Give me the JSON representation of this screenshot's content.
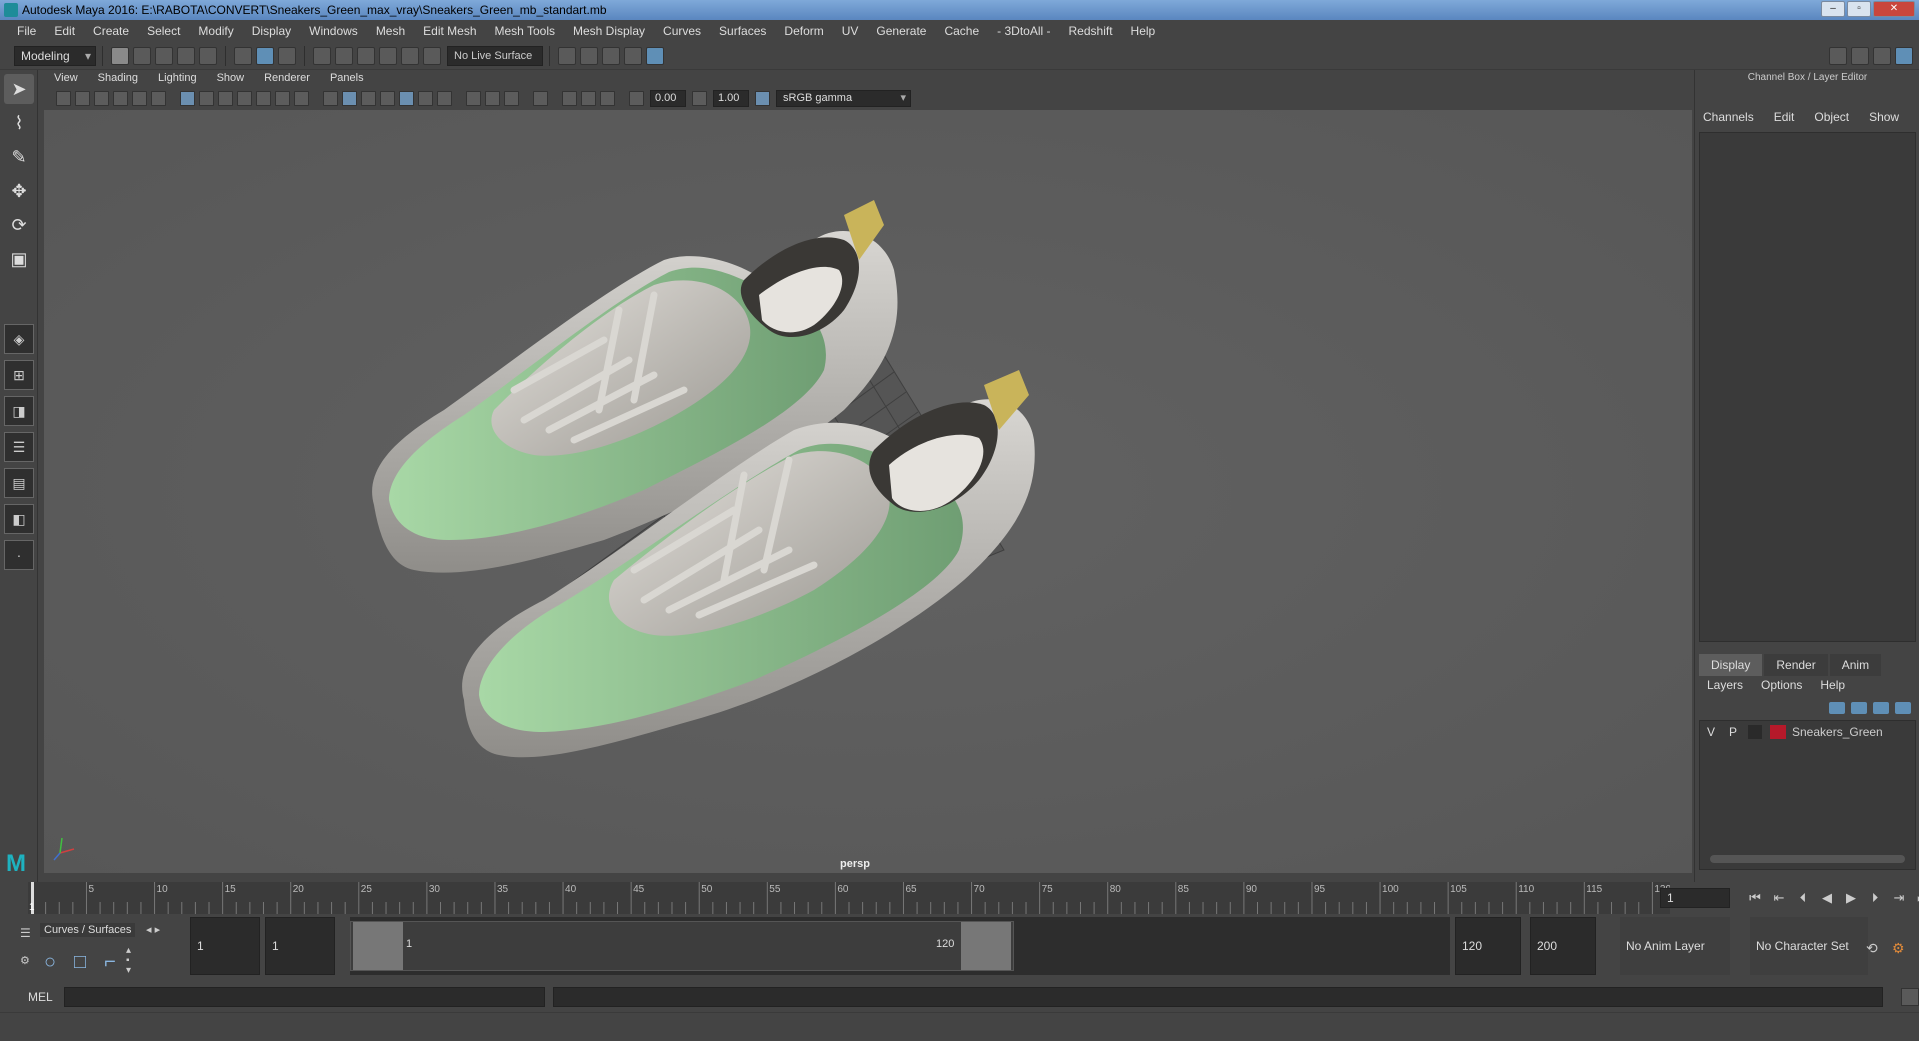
{
  "window": {
    "title": "Autodesk Maya 2016: E:\\RABOTA\\CONVERT\\Sneakers_Green_max_vray\\Sneakers_Green_mb_standart.mb"
  },
  "menubar": [
    "File",
    "Edit",
    "Create",
    "Select",
    "Modify",
    "Display",
    "Windows",
    "Mesh",
    "Edit Mesh",
    "Mesh Tools",
    "Mesh Display",
    "Curves",
    "Surfaces",
    "Deform",
    "UV",
    "Generate",
    "Cache",
    "- 3DtoAll -",
    "Redshift",
    "Help"
  ],
  "statusline": {
    "mode": "Modeling",
    "live_surface": "No Live Surface"
  },
  "panel_menu": [
    "View",
    "Shading",
    "Lighting",
    "Show",
    "Renderer",
    "Panels"
  ],
  "panel_toolbar": {
    "exposure": "0.00",
    "gamma": "1.00",
    "color_space": "sRGB gamma"
  },
  "viewport": {
    "camera": "persp",
    "background_color": "#5c5c5c",
    "sneaker_green": "#9fcf9f",
    "sneaker_gray": "#c8c6c2",
    "tab_gold": "#c9b45a"
  },
  "channel_box": {
    "title": "Channel Box / Layer Editor",
    "menu": [
      "Channels",
      "Edit",
      "Object",
      "Show"
    ]
  },
  "layer_editor": {
    "tabs": [
      "Display",
      "Render",
      "Anim"
    ],
    "active_tab": "Display",
    "menu": [
      "Layers",
      "Options",
      "Help"
    ],
    "layers": [
      {
        "visible": "V",
        "playback": "P",
        "name": "Sneakers_Green",
        "color": "#b6192a"
      }
    ]
  },
  "time_slider": {
    "start": 1,
    "end": 120,
    "major_step": 5,
    "current_frame": "1"
  },
  "range_slider": {
    "shelf_tab": "Curves / Surfaces",
    "start_field": "1",
    "anim_start_field": "1",
    "range_start_label": "1",
    "range_end_label": "120",
    "range_end_field": "120",
    "anim_end_field": "200",
    "anim_layer": "No Anim Layer",
    "character_set": "No Character Set"
  },
  "command_line": {
    "language": "MEL"
  }
}
